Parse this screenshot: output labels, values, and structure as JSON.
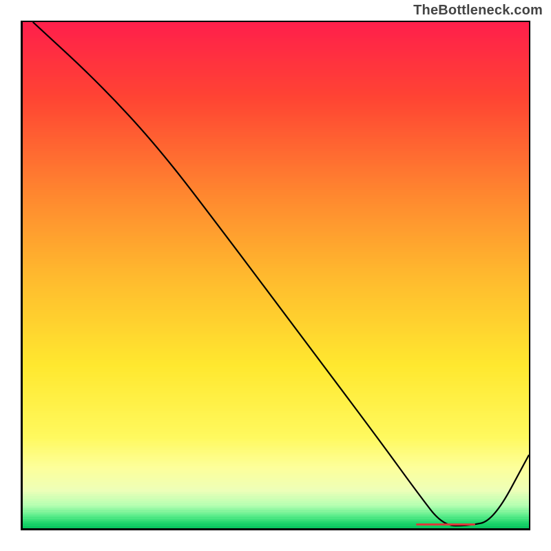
{
  "watermark": "TheBottleneck.com",
  "chart_data": {
    "type": "line",
    "title": "",
    "xlabel": "",
    "ylabel": "",
    "xlim": [
      0,
      100
    ],
    "ylim": [
      0,
      100
    ],
    "grid": false,
    "legend": false,
    "background": {
      "type": "vertical_gradient",
      "stops": [
        {
          "y_pct": 0,
          "color": "#ff1f4b"
        },
        {
          "y_pct": 15,
          "color": "#ff4433"
        },
        {
          "y_pct": 35,
          "color": "#ff8a2f"
        },
        {
          "y_pct": 50,
          "color": "#ffb92e"
        },
        {
          "y_pct": 68,
          "color": "#ffe82f"
        },
        {
          "y_pct": 82,
          "color": "#fff95e"
        },
        {
          "y_pct": 88,
          "color": "#fdff9a"
        },
        {
          "y_pct": 92.5,
          "color": "#eeffb8"
        },
        {
          "y_pct": 95.5,
          "color": "#b6ffb2"
        },
        {
          "y_pct": 97.5,
          "color": "#5fee8d"
        },
        {
          "y_pct": 99,
          "color": "#1fd66c"
        },
        {
          "y_pct": 100,
          "color": "#06c45d"
        }
      ]
    },
    "series": [
      {
        "name": "curve",
        "stroke": "#000000",
        "stroke_width": 2.2,
        "x": [
          2,
          15,
          27,
          40,
          55,
          70,
          78,
          83,
          88,
          93,
          100
        ],
        "values": [
          100,
          88,
          75,
          58,
          38,
          18,
          7,
          0.5,
          0.5,
          1.5,
          14.5
        ]
      }
    ],
    "annotations": [
      {
        "name": "flat-segment-marker",
        "type": "scatter_line",
        "color": "#d93a3a",
        "x_range": [
          78,
          89
        ],
        "y": 0.8,
        "point_count": 40
      }
    ]
  }
}
